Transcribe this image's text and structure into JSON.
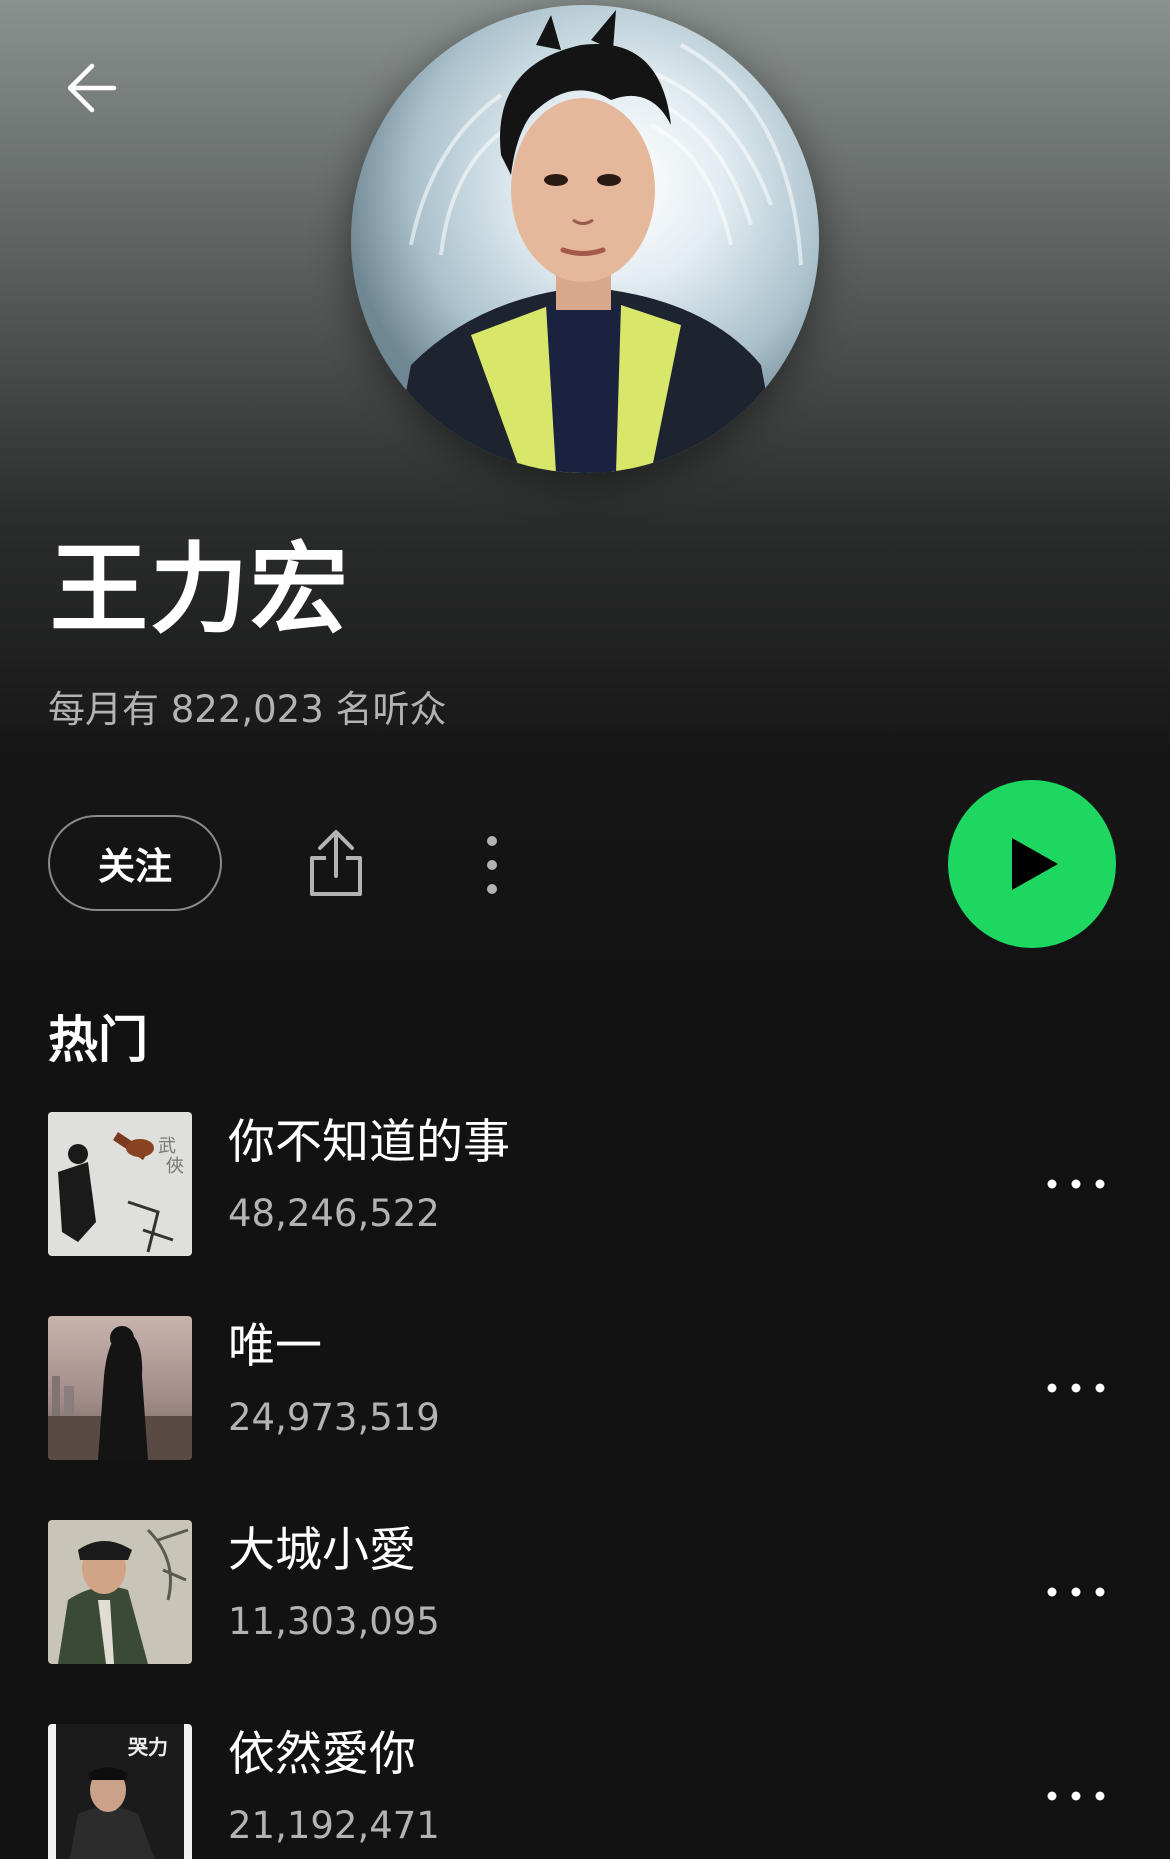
{
  "header": {
    "back_icon": "arrow-left-icon"
  },
  "artist": {
    "name": "王力宏",
    "monthly_listeners": "每月有 822,023 名听众"
  },
  "actions": {
    "follow_label": "关注",
    "share_icon": "share-icon",
    "more_icon": "more-vertical-icon",
    "play_icon": "play-icon"
  },
  "popular": {
    "title": "热门",
    "tracks": [
      {
        "title": "你不知道的事",
        "plays": "48,246,522"
      },
      {
        "title": "唯一",
        "plays": "24,973,519"
      },
      {
        "title": "大城小愛",
        "plays": "11,303,095"
      },
      {
        "title": "依然愛你",
        "plays": "21,192,471"
      }
    ]
  },
  "colors": {
    "accent": "#1ed760",
    "background": "#121212",
    "secondary_text": "#b3b3b3"
  }
}
